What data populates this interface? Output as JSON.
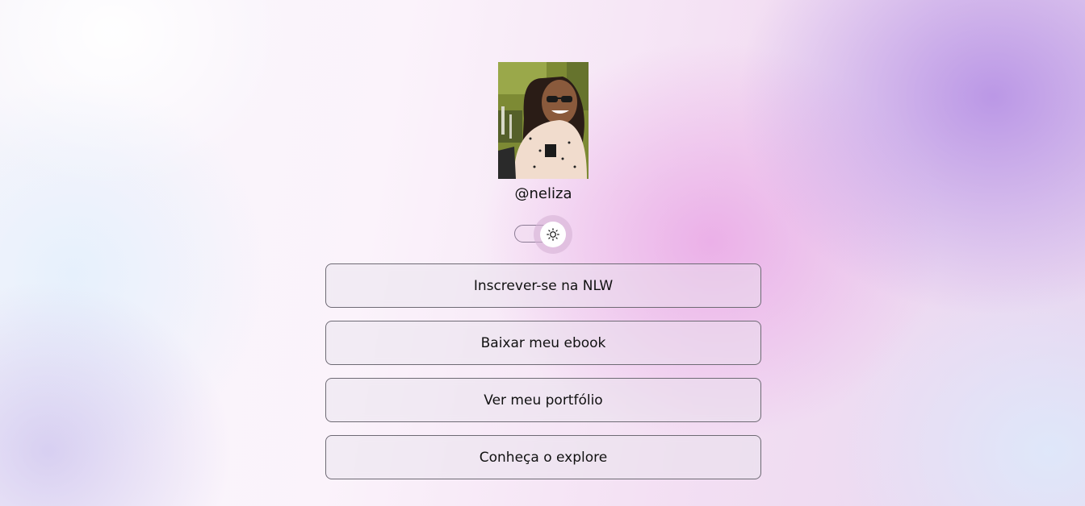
{
  "profile": {
    "username": "@neliza",
    "avatar_alt": "Foto de perfil"
  },
  "theme_switch": {
    "icon": "sun-icon",
    "state": "light"
  },
  "links": [
    {
      "label": "Inscrever-se na NLW"
    },
    {
      "label": "Baixar meu ebook"
    },
    {
      "label": "Ver meu portfólio"
    },
    {
      "label": "Conheça o explore"
    }
  ],
  "colors": {
    "link_border": "#6e6a74",
    "text": "#111111",
    "accent_purple": "#b28ce4",
    "accent_pink": "#e8a0e4"
  }
}
